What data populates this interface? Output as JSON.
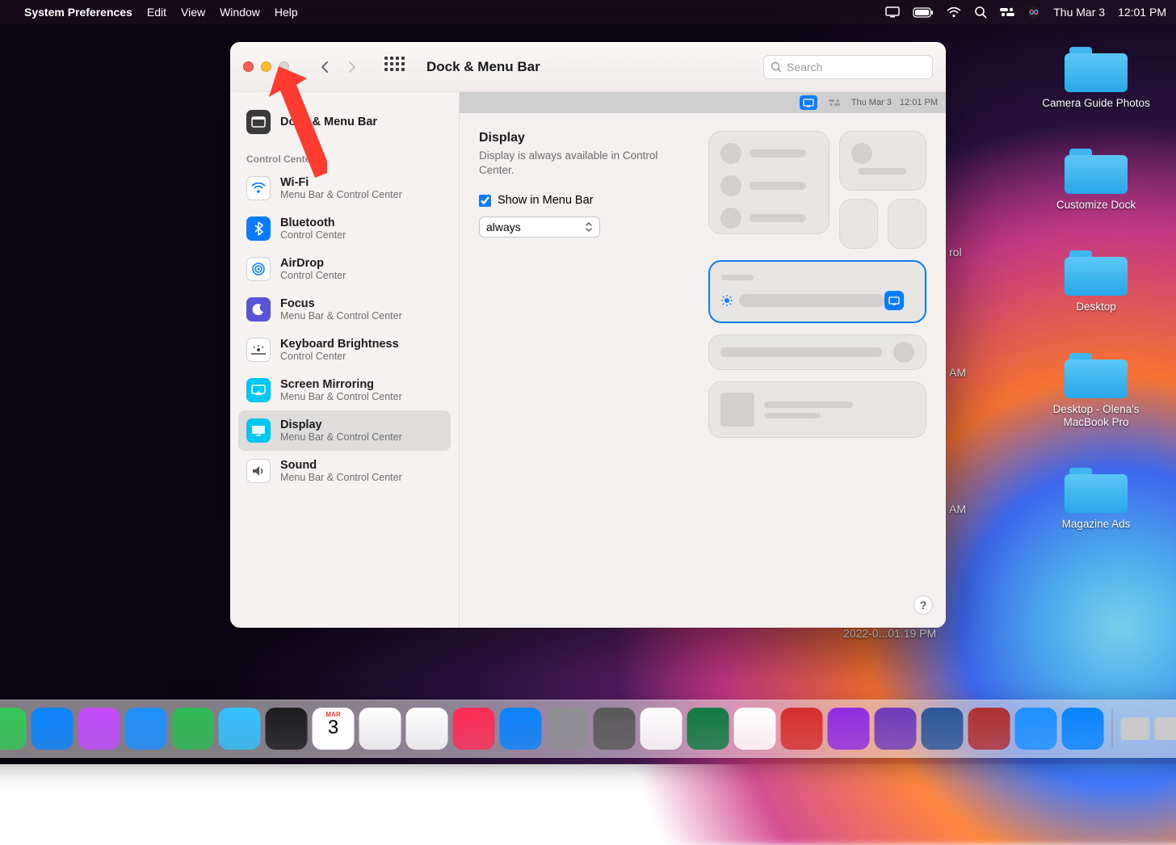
{
  "menubar": {
    "apple": "",
    "app": "System Preferences",
    "menus": [
      "Edit",
      "View",
      "Window",
      "Help"
    ],
    "date": "Thu Mar 3",
    "time": "12:01 PM"
  },
  "desktop_folders": [
    {
      "label": "Camera Guide Photos"
    },
    {
      "label": "Customize Dock"
    },
    {
      "label": "Desktop"
    },
    {
      "label": "Desktop - Olena's MacBook Pro"
    },
    {
      "label": "Magazine Ads"
    }
  ],
  "desktop_fragments": [
    {
      "text": "rol"
    },
    {
      "text": "AM"
    },
    {
      "text": "AM"
    },
    {
      "text": "2022-0...01.19 PM"
    }
  ],
  "window": {
    "title": "Dock & Menu Bar",
    "search_placeholder": "Search",
    "sidebar": {
      "top_item": {
        "title": "Dock & Menu Bar"
      },
      "section_label": "Control Center",
      "items": [
        {
          "title": "Wi-Fi",
          "subtitle": "Menu Bar & Control Center",
          "color": "#ffffff",
          "fg": "#0a7cff"
        },
        {
          "title": "Bluetooth",
          "subtitle": "Control Center",
          "color": "#0a7cff",
          "fg": "#ffffff"
        },
        {
          "title": "AirDrop",
          "subtitle": "Control Center",
          "color": "#ffffff",
          "fg": "#0a7cff"
        },
        {
          "title": "Focus",
          "subtitle": "Menu Bar & Control Center",
          "color": "#5856d6",
          "fg": "#ffffff"
        },
        {
          "title": "Keyboard Brightness",
          "subtitle": "Control Center",
          "color": "#ffffff",
          "fg": "#444444"
        },
        {
          "title": "Screen Mirroring",
          "subtitle": "Menu Bar & Control Center",
          "color": "#00c7f2",
          "fg": "#ffffff"
        },
        {
          "title": "Display",
          "subtitle": "Menu Bar & Control Center",
          "color": "#00c7f2",
          "fg": "#ffffff",
          "selected": true
        },
        {
          "title": "Sound",
          "subtitle": "Menu Bar & Control Center",
          "color": "#ffffff",
          "fg": "#555555"
        }
      ]
    },
    "main": {
      "preview_date": "Thu Mar 3",
      "preview_time": "12:01 PM",
      "heading": "Display",
      "description": "Display is always available in Control Center.",
      "checkbox_label": "Show in Menu Bar",
      "checkbox_checked": true,
      "select_value": "always"
    },
    "help": "?"
  },
  "dock_colors": [
    "#2ea7ff",
    "#f0f0f0",
    "#34c759",
    "#34c759",
    "#0a84ff",
    "#c44cff",
    "#1e90ff",
    "#2fba55",
    "#33c1ff",
    "#1c1c1e",
    "#ff3b30",
    "#ffffff",
    "#ffffff",
    "#ff2d55",
    "#0a84ff",
    "#8e8e93",
    "#5a5a5a",
    "#ffffff",
    "#107c41",
    "#ffffff",
    "#d62f2f",
    "#8e2de2",
    "#6e3cbc",
    "#2b579a",
    "#b03030",
    "#1e90ff",
    "#0a84ff"
  ],
  "dock_minis": [
    "#c9c9c9",
    "#c9c9c9",
    "#c9c9c9",
    "#c9c9c9",
    "#c9c9c9"
  ],
  "calendar_day": "3",
  "calendar_month": "MAR"
}
